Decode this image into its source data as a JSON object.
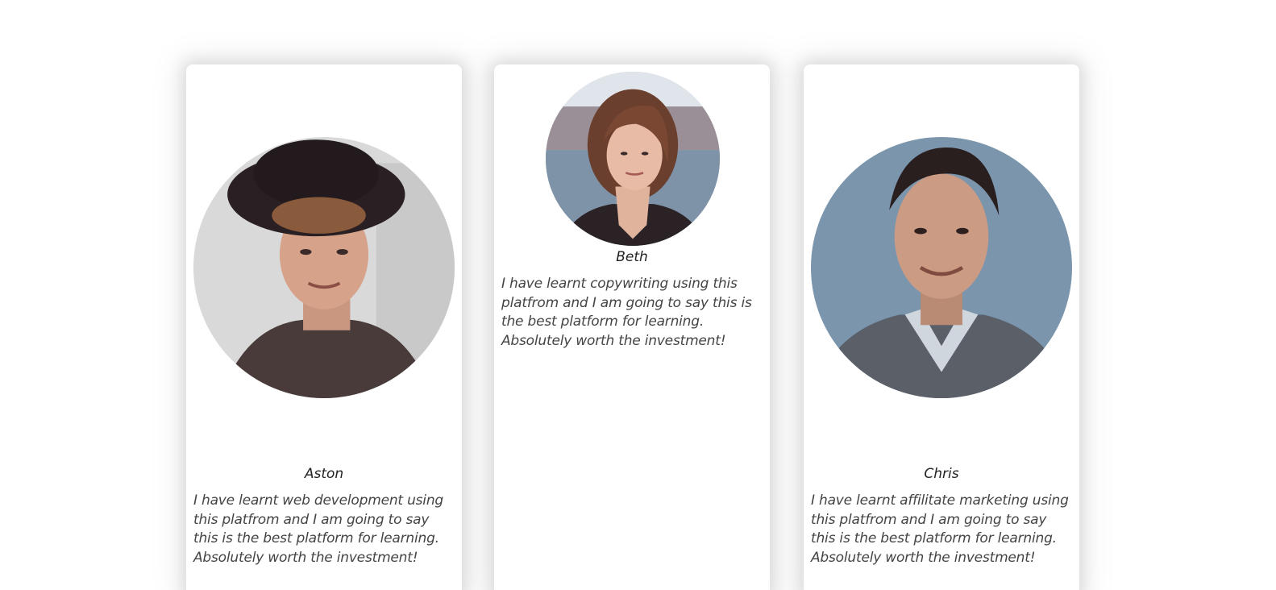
{
  "testimonials": [
    {
      "name": "Aston",
      "quote": "I have learnt web development using this platfrom and I am going to say this is the best platform for learning. Absolutely worth the investment!",
      "avatar_icon": "person-photo"
    },
    {
      "name": "Beth",
      "quote": "I have learnt copywriting using this platfrom and I am going to say this is the best platform for learning. Absolutely worth the investment!",
      "avatar_icon": "person-photo"
    },
    {
      "name": "Chris",
      "quote": "I have learnt affilitate marketing using this platfrom and I am going to say this is the best platform for learning. Absolutely worth the investment!",
      "avatar_icon": "person-photo"
    }
  ]
}
